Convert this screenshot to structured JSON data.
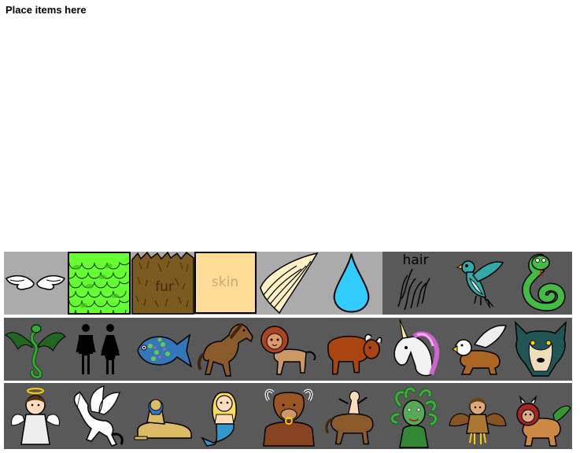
{
  "instruction": "Place items here",
  "texture_labels": {
    "fur": "fur",
    "skin": "skin",
    "hair": "hair"
  },
  "colors": {
    "row_background": "#595959",
    "light_background": "#ababab",
    "scales_green": "#66ff33",
    "fur_brown": "#7a5a1e",
    "skin_peach": "#ffdd99",
    "water_blue": "#33ccff"
  },
  "rows": [
    {
      "items": [
        {
          "name": "wings-icon"
        },
        {
          "name": "scales-icon"
        },
        {
          "name": "fur-icon"
        },
        {
          "name": "skin-icon"
        },
        {
          "name": "horn-icon"
        },
        {
          "name": "water-drop-icon"
        },
        {
          "name": "hair-icon"
        },
        {
          "name": "bird-icon"
        },
        {
          "name": "snake-icon"
        }
      ]
    },
    {
      "items": [
        {
          "name": "dragon-icon"
        },
        {
          "name": "people-icon"
        },
        {
          "name": "fish-icon"
        },
        {
          "name": "horse-icon"
        },
        {
          "name": "lion-icon"
        },
        {
          "name": "bull-icon"
        },
        {
          "name": "unicorn-icon"
        },
        {
          "name": "griffin-icon"
        },
        {
          "name": "wolf-icon"
        }
      ]
    },
    {
      "items": [
        {
          "name": "angel-icon"
        },
        {
          "name": "pegasus-icon"
        },
        {
          "name": "sphinx-icon"
        },
        {
          "name": "mermaid-icon"
        },
        {
          "name": "minotaur-icon"
        },
        {
          "name": "centaur-icon"
        },
        {
          "name": "medusa-icon"
        },
        {
          "name": "harpy-icon"
        },
        {
          "name": "manticore-icon"
        }
      ]
    }
  ]
}
